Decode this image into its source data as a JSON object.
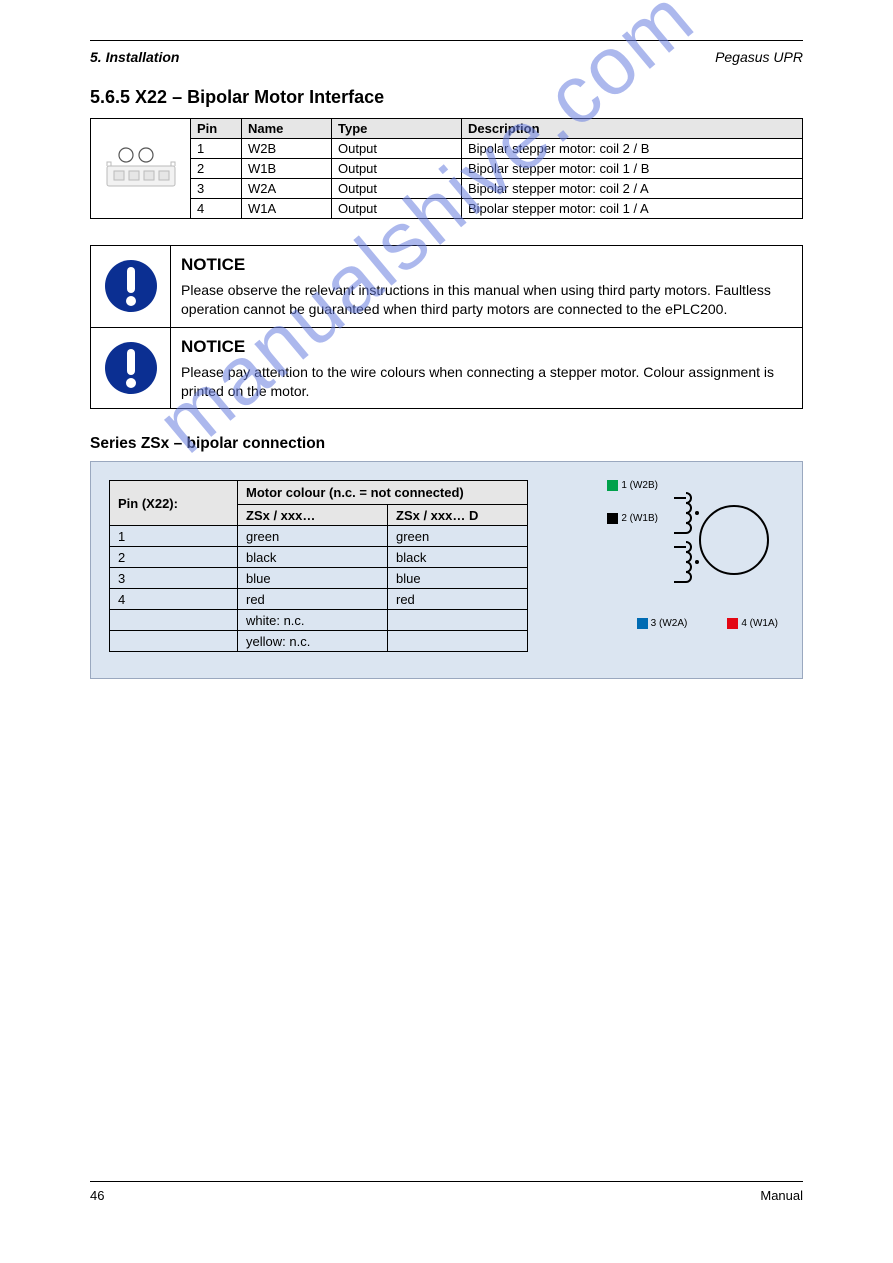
{
  "header": {
    "section_ref": "5. Installation",
    "product": "Pegasus UPR",
    "title": "5.6.5 X22 – Bipolar Motor Interface"
  },
  "x22_table": {
    "headers": [
      "Pin",
      "Name",
      "Type",
      "Description"
    ],
    "rows": [
      [
        "1",
        "W2B",
        "Output",
        "Bipolar stepper motor: coil 2 / B"
      ],
      [
        "2",
        "W1B",
        "Output",
        "Bipolar stepper motor: coil 1 / B"
      ],
      [
        "3",
        "W2A",
        "Output",
        "Bipolar stepper motor: coil 2 / A"
      ],
      [
        "4",
        "W1A",
        "Output",
        "Bipolar stepper motor: coil 1 / A"
      ]
    ]
  },
  "notice1": {
    "heading": "NOTICE",
    "text": "Please observe the relevant instructions in this manual when using third party motors. Faultless operation cannot be guaranteed when third party motors are connected to the ePLC200."
  },
  "notice2": {
    "heading": "NOTICE",
    "text": "Please pay attention to the wire colours when connecting a stepper motor. Colour assignment is printed on the motor."
  },
  "motor_section": {
    "title": "Series ZSx – bipolar connection",
    "pin_hdr": "Pin (X22):",
    "col_hdr": "Motor colour (n.c. = not connected)",
    "sub1": "ZSx / xxx…",
    "sub2": "ZSx / xxx… D",
    "rows": [
      {
        "pin": "1",
        "c1": "green",
        "c2": "green"
      },
      {
        "pin": "2",
        "c1": "black",
        "c2": "black"
      },
      {
        "pin": "3",
        "c1": "blue",
        "c2": "blue"
      },
      {
        "pin": "4",
        "c1": "red",
        "c2": "red"
      },
      {
        "pin": "",
        "c1": "white: n.c.",
        "c2": ""
      },
      {
        "pin": "",
        "c1": "yellow: n.c.",
        "c2": ""
      }
    ],
    "legend": {
      "w2b": "1 (W2B)",
      "w1b": "2 (W1B)",
      "w2a": "3 (W2A)",
      "w1a": "4 (W1A)"
    }
  },
  "watermark": "manualshive.com",
  "footer": {
    "left": "46",
    "right": "Manual"
  }
}
